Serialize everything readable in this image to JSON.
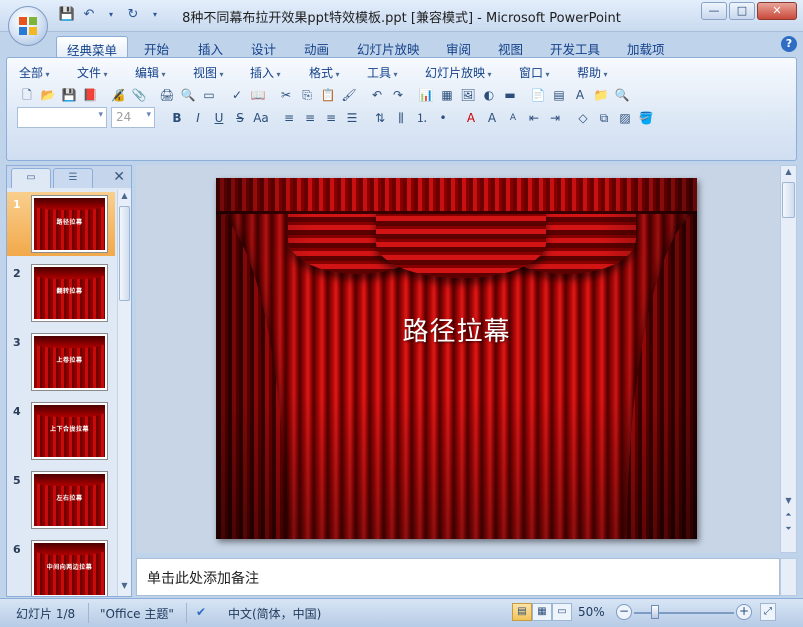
{
  "window": {
    "title": "8种不同幕布拉开效果ppt特效模板.ppt [兼容模式] - Microsoft PowerPoint",
    "controls": [
      "—",
      "□",
      "✕"
    ]
  },
  "ribbon_tabs": [
    "经典菜单",
    "开始",
    "插入",
    "设计",
    "动画",
    "幻灯片放映",
    "审阅",
    "视图",
    "开发工具",
    "加载项"
  ],
  "active_tab": "经典菜单",
  "classic_menus": [
    "全部",
    "文件",
    "编辑",
    "视图",
    "插入",
    "格式",
    "工具",
    "幻灯片放映",
    "窗口",
    "帮助"
  ],
  "font": {
    "name": "",
    "size": "24"
  },
  "slides_pane": {
    "tabs": [
      "slides-icon",
      "outline-icon"
    ],
    "thumbnails": [
      {
        "number": "1",
        "label": "路径拉幕",
        "selected": true
      },
      {
        "number": "2",
        "label": "翻转拉幕",
        "selected": false
      },
      {
        "number": "3",
        "label": "上卷拉幕",
        "selected": false
      },
      {
        "number": "4",
        "label": "上下合拢拉幕",
        "selected": false
      },
      {
        "number": "5",
        "label": "左右拉幕",
        "selected": false
      },
      {
        "number": "6",
        "label": "中间向两边拉幕",
        "selected": false
      }
    ]
  },
  "slide": {
    "title": "路径拉幕"
  },
  "notes": {
    "placeholder": "单击此处添加备注"
  },
  "status": {
    "slide_position": "幻灯片 1/8",
    "theme": "\"Office 主题\"",
    "language": "中文(简体，中国)",
    "zoom": "50%"
  },
  "colors": {
    "curtain_red": "#c80a0a",
    "selected_thumb": "#f2a94a",
    "ribbon_blue": "#bfd3ea"
  }
}
